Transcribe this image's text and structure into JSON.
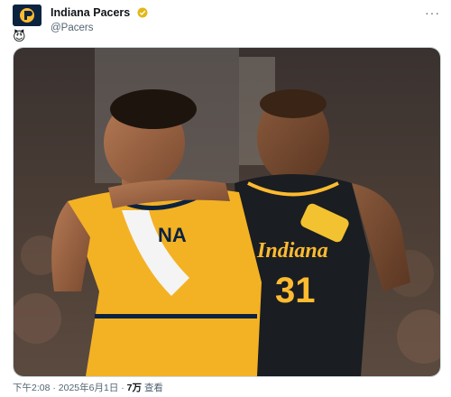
{
  "account": {
    "display_name": "Indiana Pacers",
    "handle": "@Pacers",
    "verified_badge": "verified-gold-badge",
    "avatar_icon": "pacers-logo-icon"
  },
  "tweet": {
    "text_emoji": "😈",
    "more_icon": "more-options-icon",
    "media": {
      "jersey_name": "Indiana",
      "jersey_number": "31",
      "short_name": "NA"
    }
  },
  "meta": {
    "time": "下午2:08",
    "separator": "·",
    "date": "2025年6月1日",
    "views_count": "7万",
    "views_label": "查看"
  },
  "colors": {
    "pacers_gold": "#fdbb30",
    "pacers_navy": "#0c2340"
  }
}
